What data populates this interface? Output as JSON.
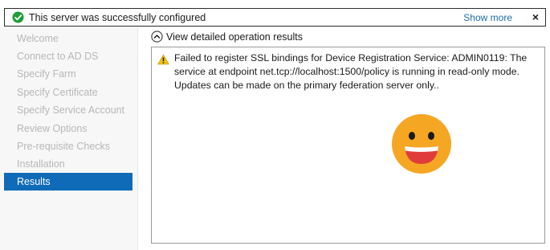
{
  "banner": {
    "message": "This server was successfully configured",
    "show_more": "Show more",
    "close": "×"
  },
  "sidebar": {
    "items": [
      {
        "label": "Welcome",
        "active": false
      },
      {
        "label": "Connect to AD DS",
        "active": false
      },
      {
        "label": "Specify Farm",
        "active": false
      },
      {
        "label": "Specify Certificate",
        "active": false
      },
      {
        "label": "Specify Service Account",
        "active": false
      },
      {
        "label": "Review Options",
        "active": false
      },
      {
        "label": "Pre-requisite Checks",
        "active": false
      },
      {
        "label": "Installation",
        "active": false
      },
      {
        "label": "Results",
        "active": true
      }
    ]
  },
  "main": {
    "toggle_label": "View detailed operation results",
    "warning": "Failed to register SSL bindings for Device Registration Service: ADMIN0119: The service at endpoint net.tcp://localhost:1500/policy is running in read-only mode. Updates can be made on the primary federation server only.."
  },
  "colors": {
    "accent": "#0f6bb8",
    "success": "#1e9e3a",
    "warning": "#f2c200",
    "emoji_face": "#f5a623",
    "emoji_mouth": "#e03c3c"
  },
  "icons": {
    "success": "check-circle-icon",
    "toggle": "chevron-up-circle-icon",
    "warning": "warning-triangle-icon",
    "emoji": "grinning-face-emoji"
  }
}
